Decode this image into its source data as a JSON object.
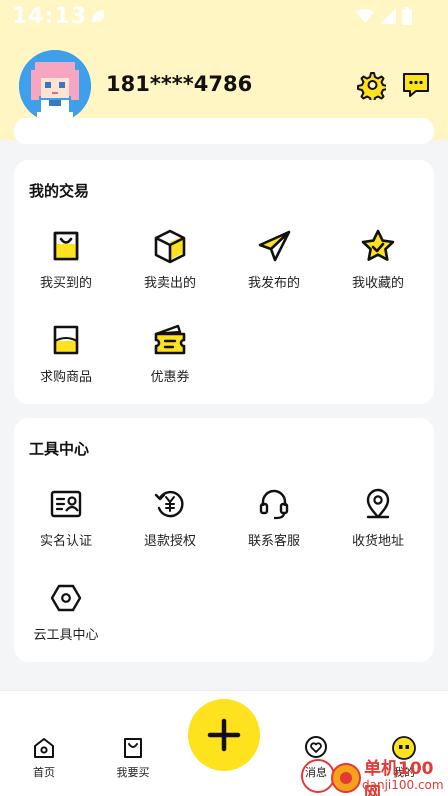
{
  "status_bar": {
    "time": "14:13"
  },
  "profile": {
    "phone": "181****4786"
  },
  "header_icons": {
    "settings": "gear-icon",
    "messages": "chat-bubble-icon"
  },
  "trade": {
    "title": "我的交易",
    "items": [
      {
        "label": "我买到的",
        "icon": "shopping-bag-icon"
      },
      {
        "label": "我卖出的",
        "icon": "box-icon"
      },
      {
        "label": "我发布的",
        "icon": "paper-plane-icon"
      },
      {
        "label": "我收藏的",
        "icon": "star-icon"
      },
      {
        "label": "求购商品",
        "icon": "request-bag-icon"
      },
      {
        "label": "优惠券",
        "icon": "coupon-icon"
      }
    ]
  },
  "tools": {
    "title": "工具中心",
    "items": [
      {
        "label": "实名认证",
        "icon": "id-card-icon"
      },
      {
        "label": "退款授权",
        "icon": "refund-yen-icon"
      },
      {
        "label": "联系客服",
        "icon": "headset-icon"
      },
      {
        "label": "收货地址",
        "icon": "location-pin-icon"
      },
      {
        "label": "云工具中心",
        "icon": "hexagon-icon"
      }
    ]
  },
  "bottom_nav": {
    "tabs": [
      {
        "label": "首页",
        "icon": "home-icon"
      },
      {
        "label": "我要买",
        "icon": "bag-icon"
      },
      {
        "label": "消息",
        "icon": "heart-chat-icon"
      },
      {
        "label": "我的",
        "icon": "face-icon"
      }
    ],
    "fab": "plus-icon"
  },
  "watermark": {
    "main": "单机100网",
    "sub": "danji100.com"
  },
  "colors": {
    "accent": "#ffe21e",
    "header_bg": "#fff6c4",
    "avatar_bg": "#3ea0ea"
  }
}
